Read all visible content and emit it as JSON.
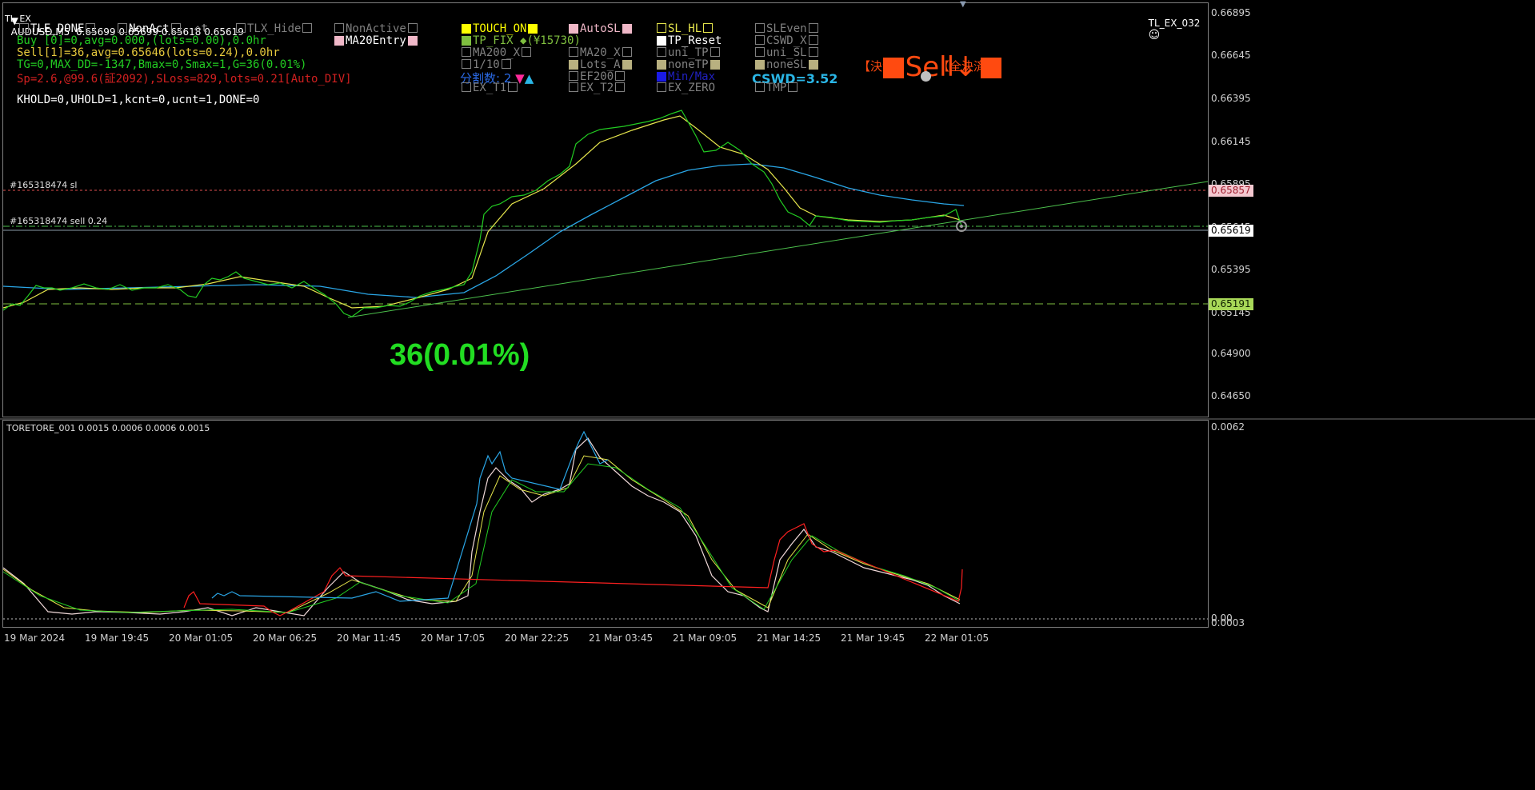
{
  "header": {
    "symbol_line": "AUDUSD,M5  0.65699 0.65699 0.65618 0.65619",
    "indicator_name": "TL_EX",
    "ea_name": "TL_EX_032"
  },
  "status": {
    "buy": "Buy [0]=0,avg=0.000,(lots=0.00),0.0hr",
    "sell": "Sell[1]=36,avg=0.65646(lots=0.24),0.0hr",
    "tg": "TG=0,MAX_DD=-1347,Bmax=0,Smax=1,G=36(0.01%)",
    "sp": "Sp=2.6,@99.6(証2092),SLoss=829,lots=0.21[Auto_DIV]",
    "khold": "KHOLD=0,UHOLD=1,kcnt=0,ucnt=1,DONE=0"
  },
  "controls": {
    "tle_done": "TLE_DONE",
    "nonact": "NonAct",
    "t": "t",
    "tlx_hide": "TLX_Hide",
    "nonactive": "NonActive",
    "ma20entry": "MA20Entry",
    "touch_on": "TOUCH_ON",
    "autosl": "AutoSL",
    "sl_hl": "SL_HL",
    "sleven": "SLEven",
    "tp_fix": "TP_FIX",
    "tp_fix_value": "(¥15730)",
    "tp_reset": "TP_Reset",
    "cswd_x": "CSWD_X",
    "ma200_x": "MA200_X",
    "ma20_x": "MA20_X",
    "uni_tp": "uni_TP",
    "uni_sl": "uni_SL",
    "one_tenth": "1/10",
    "lots_a": "Lots_A",
    "nonetp": "noneTP",
    "nonesl": "noneSL",
    "split_count": "分割数: 2",
    "ef200": "EF200",
    "minmax": "Min/Max",
    "cswd_value": "CSWD=3.52",
    "ex_t1": "EX_T1",
    "ex_t2": "EX_T2",
    "ex_zero": "EX_ZERO",
    "tmp": "TMP"
  },
  "trade": {
    "sell_label": "Sell↓",
    "settle": "【決済】",
    "settle_all": "【全決済】"
  },
  "main_chart": {
    "ticket_sl": "#165318474 sl",
    "ticket_sell": "#165318474 sell 0.24",
    "big_profit": "36(0.01%)",
    "price_ticks": [
      "0.66895",
      "0.66645",
      "0.66395",
      "0.66145",
      "0.65895",
      "0.65645",
      "0.65395",
      "0.65145",
      "0.64900",
      "0.64650"
    ],
    "tag_sl": "0.65857",
    "tag_current": "0.65619",
    "tag_tp": "0.65191"
  },
  "sub_chart": {
    "title": "TORETORE_001 0.0015 0.0006 0.0006 0.0015",
    "tick_top": "0.0062",
    "tick_zero": "0.00",
    "tick_bottom": "0.0003"
  },
  "time_axis": [
    "19 Mar 2024",
    "19 Mar 19:45",
    "20 Mar 01:05",
    "20 Mar 06:25",
    "20 Mar 11:45",
    "20 Mar 17:05",
    "20 Mar 22:25",
    "21 Mar 03:45",
    "21 Mar 09:05",
    "21 Mar 14:25",
    "21 Mar 19:45",
    "22 Mar 01:05"
  ],
  "colors": {
    "price_line": "#22cc22",
    "ma_fast": "#e6e64c",
    "ma_slow": "#2aa6e6",
    "trend": "#4cc04c",
    "sl_line": "#e05050",
    "tp_line": "#7fbf3f",
    "accent_orange": "#ff4a10"
  },
  "icons": {
    "smiley": "smiley-icon",
    "triangles": "triangle-icon"
  }
}
